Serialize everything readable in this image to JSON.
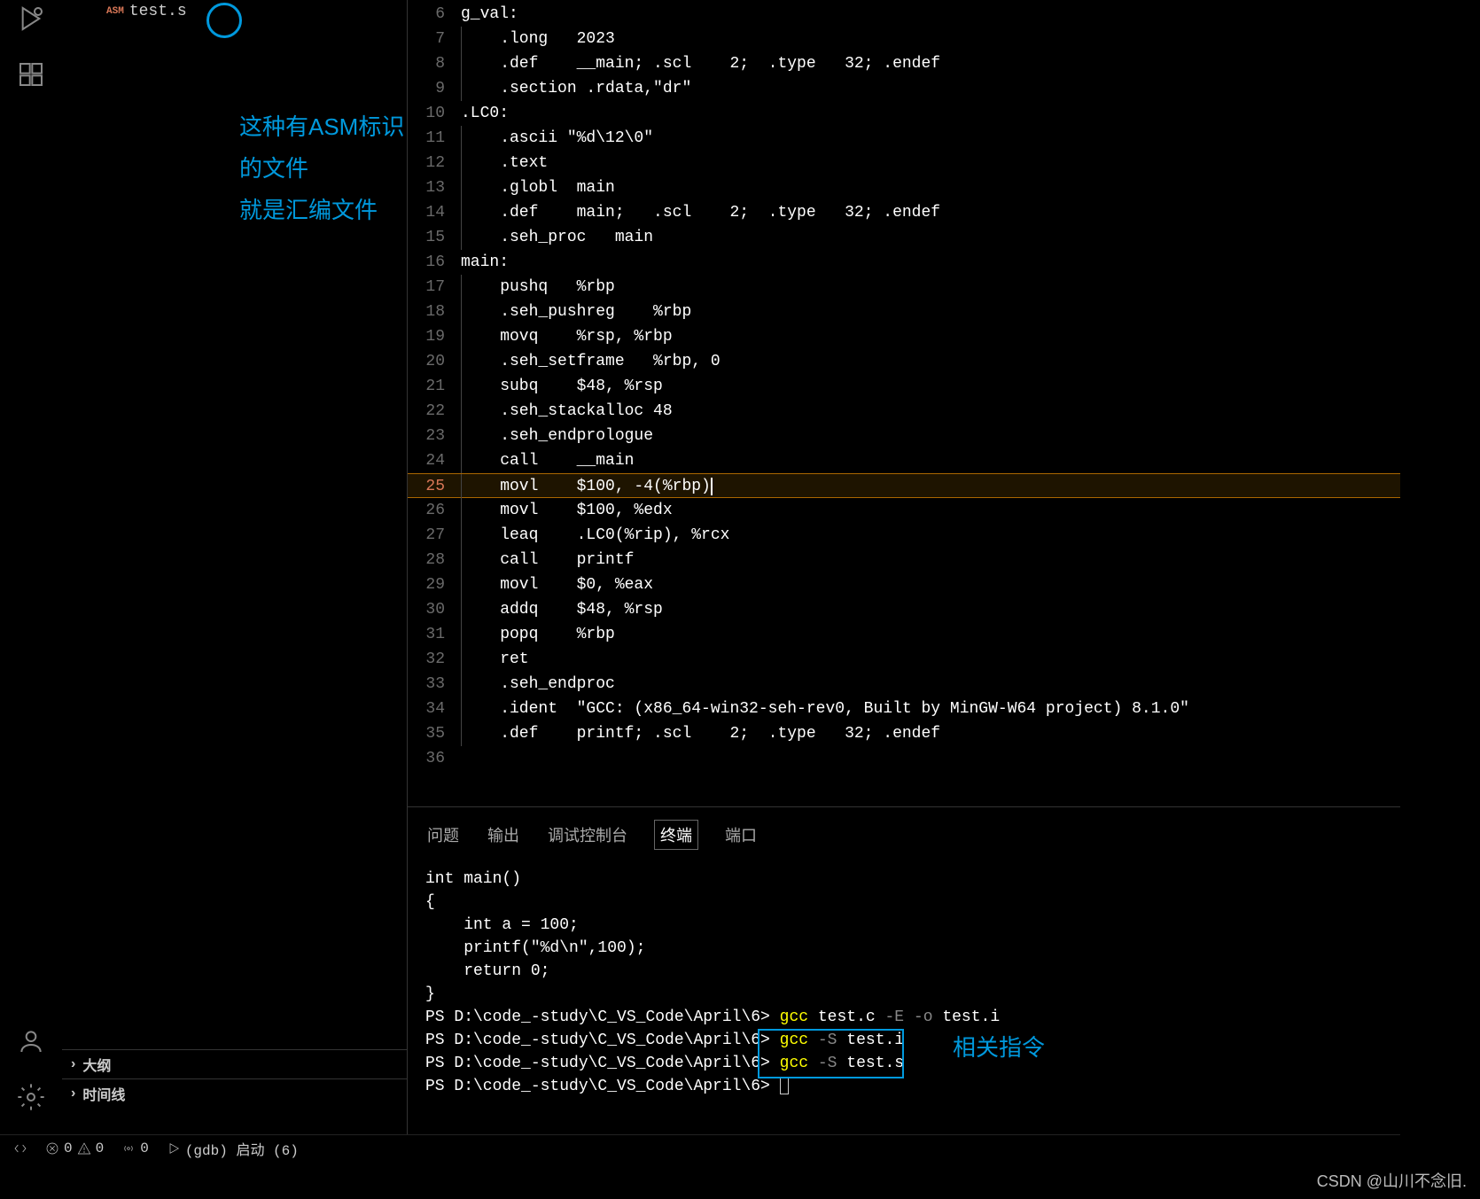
{
  "sidebar": {
    "file": {
      "badge": "ASM",
      "name": "test.s"
    },
    "annotation": {
      "line1": "这种有ASM标识的文件",
      "line2": "就是汇编文件"
    },
    "outline": "大纲",
    "timeline": "时间线"
  },
  "editor": {
    "active_line": 25,
    "lines": [
      {
        "n": 6,
        "indent": 0,
        "text": "g_val:"
      },
      {
        "n": 7,
        "indent": 1,
        "text": "    .long   2023"
      },
      {
        "n": 8,
        "indent": 1,
        "text": "    .def    __main; .scl    2;  .type   32; .endef"
      },
      {
        "n": 9,
        "indent": 1,
        "text": "    .section .rdata,\"dr\""
      },
      {
        "n": 10,
        "indent": 0,
        "text": ".LC0:"
      },
      {
        "n": 11,
        "indent": 1,
        "text": "    .ascii \"%d\\12\\0\""
      },
      {
        "n": 12,
        "indent": 1,
        "text": "    .text"
      },
      {
        "n": 13,
        "indent": 1,
        "text": "    .globl  main"
      },
      {
        "n": 14,
        "indent": 1,
        "text": "    .def    main;   .scl    2;  .type   32; .endef"
      },
      {
        "n": 15,
        "indent": 1,
        "text": "    .seh_proc   main"
      },
      {
        "n": 16,
        "indent": 0,
        "text": "main:"
      },
      {
        "n": 17,
        "indent": 1,
        "text": "    pushq   %rbp"
      },
      {
        "n": 18,
        "indent": 1,
        "text": "    .seh_pushreg    %rbp"
      },
      {
        "n": 19,
        "indent": 1,
        "text": "    movq    %rsp, %rbp"
      },
      {
        "n": 20,
        "indent": 1,
        "text": "    .seh_setframe   %rbp, 0"
      },
      {
        "n": 21,
        "indent": 1,
        "text": "    subq    $48, %rsp"
      },
      {
        "n": 22,
        "indent": 1,
        "text": "    .seh_stackalloc 48"
      },
      {
        "n": 23,
        "indent": 1,
        "text": "    .seh_endprologue"
      },
      {
        "n": 24,
        "indent": 1,
        "text": "    call    __main"
      },
      {
        "n": 25,
        "indent": 1,
        "text": "    movl    $100, -4(%rbp)"
      },
      {
        "n": 26,
        "indent": 1,
        "text": "    movl    $100, %edx"
      },
      {
        "n": 27,
        "indent": 1,
        "text": "    leaq    .LC0(%rip), %rcx"
      },
      {
        "n": 28,
        "indent": 1,
        "text": "    call    printf"
      },
      {
        "n": 29,
        "indent": 1,
        "text": "    movl    $0, %eax"
      },
      {
        "n": 30,
        "indent": 1,
        "text": "    addq    $48, %rsp"
      },
      {
        "n": 31,
        "indent": 1,
        "text": "    popq    %rbp"
      },
      {
        "n": 32,
        "indent": 1,
        "text": "    ret"
      },
      {
        "n": 33,
        "indent": 1,
        "text": "    .seh_endproc"
      },
      {
        "n": 34,
        "indent": 1,
        "text": "    .ident  \"GCC: (x86_64-win32-seh-rev0, Built by MinGW-W64 project) 8.1.0\""
      },
      {
        "n": 35,
        "indent": 1,
        "text": "    .def    printf; .scl    2;  .type   32; .endef"
      },
      {
        "n": 36,
        "indent": 0,
        "text": ""
      }
    ]
  },
  "panel": {
    "tabs": {
      "problems": "问题",
      "output": "输出",
      "debug": "调试控制台",
      "terminal": "终端",
      "ports": "端口"
    },
    "terminal": {
      "code": [
        "int main()",
        "{",
        "    int a = 100;",
        "    printf(\"%d\\n\",100);",
        "    return 0;",
        "}"
      ],
      "prompt": "PS D:\\code_-study\\C_VS_Code\\April\\6>",
      "cmd1": {
        "gcc": "gcc",
        "rest": " test.c ",
        "opt1": "-E",
        "opt2": " -o",
        "rest2": " test.i"
      },
      "cmd2": {
        "gcc": "gcc",
        "opt": " -S",
        "rest": " test.i"
      },
      "cmd3": {
        "gcc": "gcc",
        "opt": " -S",
        "rest": " test.s"
      },
      "annotation": "相关指令"
    }
  },
  "status": {
    "errors": "0",
    "warnings": "0",
    "radio": "0",
    "launch": "(gdb) 启动 (6)"
  },
  "watermark": "CSDN @山川不念旧."
}
